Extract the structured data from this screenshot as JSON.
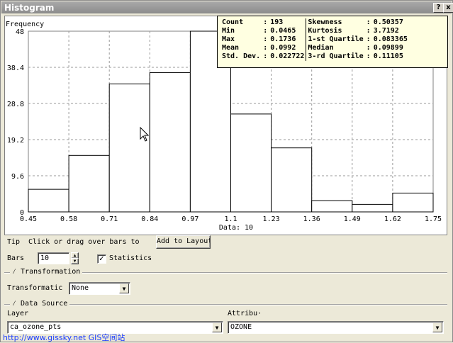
{
  "window": {
    "title": "Histogram",
    "help_glyph": "?",
    "close_glyph": "x"
  },
  "chart_data": {
    "type": "bar",
    "ylabel": "Frequency",
    "xlabel": "Data: 10",
    "bin_edges": [
      0.45,
      0.58,
      0.71,
      0.84,
      0.97,
      1.1,
      1.23,
      1.36,
      1.49,
      1.62,
      1.75
    ],
    "x_tick_labels": [
      "0.45",
      "0.58",
      "0.71",
      "0.84",
      "0.97",
      "1.1",
      "1.23",
      "1.36",
      "1.49",
      "1.62",
      "1.75"
    ],
    "values": [
      6,
      15,
      34,
      37,
      48,
      26,
      17,
      3,
      2,
      5
    ],
    "ylim": [
      0,
      48
    ],
    "y_ticks": [
      0,
      9.6,
      19.2,
      28.8,
      38.4,
      48
    ],
    "y_tick_labels": [
      "0",
      "9.6",
      "19.2",
      "28.8",
      "38.4",
      "48"
    ],
    "grid": true,
    "bar_color": "#ffffff"
  },
  "stats": {
    "rows": [
      {
        "l1": "Count",
        "v1": "193",
        "l2": "Skewness",
        "v2": "0.50357"
      },
      {
        "l1": "Min",
        "v1": "0.0465",
        "l2": "Kurtosis",
        "v2": "3.7192"
      },
      {
        "l1": "Max",
        "v1": "0.1736",
        "l2": "1-st Quartile",
        "v2": "0.083365"
      },
      {
        "l1": "Mean",
        "v1": "0.0992",
        "l2": "Median",
        "v2": "0.09899"
      },
      {
        "l1": "Std. Dev.",
        "v1": "0.022722",
        "l2": "3-rd Quartile",
        "v2": "0.11105"
      }
    ],
    "colon": ":"
  },
  "controls": {
    "tip_label": "Tip",
    "tip_text": "Click or drag over bars to",
    "add_to_layout": "Add to Layout",
    "bars_label": "Bars",
    "bars_value": "10",
    "statistics_label": "Statistics",
    "statistics_checked": "✓",
    "transformation_group": "Transformation",
    "transformation_label": "Transformatic",
    "transformation_value": "None",
    "data_source_group": "Data Source",
    "layer_label": "Layer",
    "layer_value": "ca_ozone_pts",
    "attribute_label": "Attribu·",
    "attribute_value": "OZONE"
  },
  "watermark": "http://www.gissky.net     GIS空间站"
}
